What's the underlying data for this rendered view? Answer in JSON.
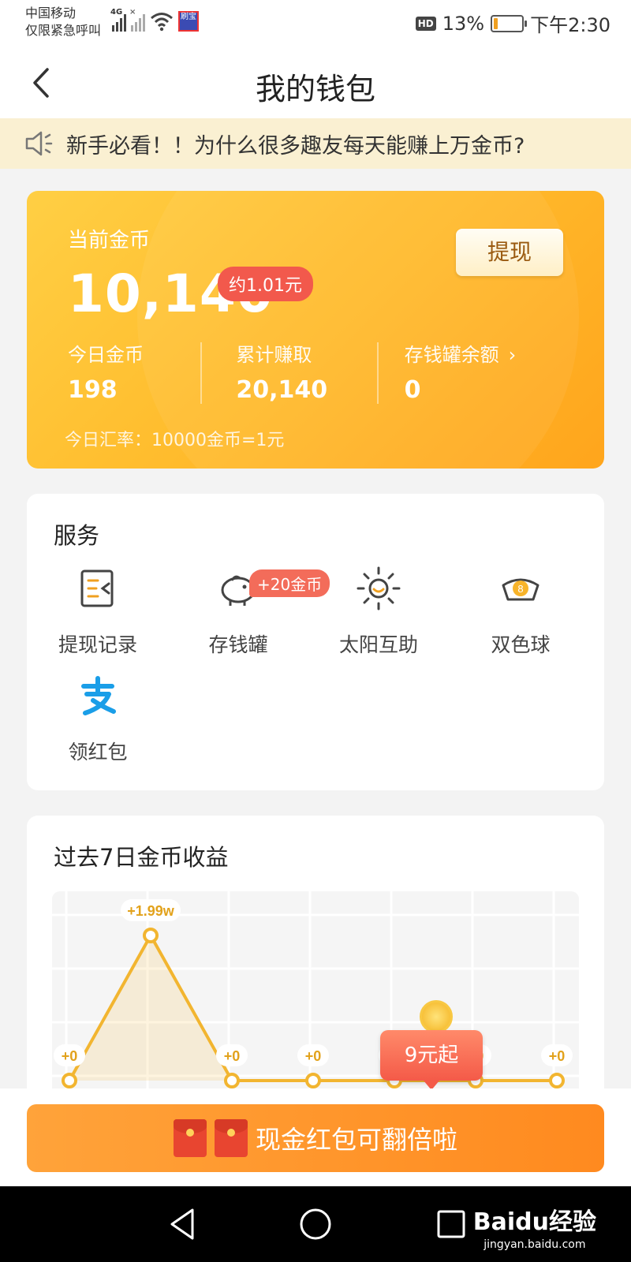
{
  "status_bar": {
    "carrier_line1": "中国移动",
    "carrier_line2": "仅限紧急呼叫",
    "network_tag": "4G",
    "app_badge": "刷宝",
    "hd": "HD",
    "battery_percent": "13%",
    "battery_level": 0.13,
    "time": "下午2:30"
  },
  "header": {
    "title": "我的钱包"
  },
  "notice": {
    "text": "新手必看！！为什么很多趣友每天能赚上万金币?"
  },
  "wallet": {
    "label": "当前金币",
    "amount": "10,140",
    "approx": "约1.01元",
    "withdraw_label": "提现",
    "stats": [
      {
        "label": "今日金币",
        "value": "198"
      },
      {
        "label": "累计赚取",
        "value": "20,140"
      },
      {
        "label": "存钱罐余额",
        "value": "0"
      }
    ],
    "rate": "今日汇率：10000金币=1元"
  },
  "services": {
    "title": "服务",
    "items": [
      {
        "label": "提现记录",
        "icon": "withdraw-record-icon"
      },
      {
        "label": "存钱罐",
        "icon": "piggy-bank-icon",
        "badge": "+20金币"
      },
      {
        "label": "太阳互助",
        "icon": "sun-icon"
      },
      {
        "label": "双色球",
        "icon": "lottery-ball-icon"
      },
      {
        "label": "领红包",
        "icon": "alipay-icon"
      }
    ]
  },
  "chart_card": {
    "title": "过去7日金币收益",
    "promo": "9元起"
  },
  "chart_data": {
    "type": "line",
    "point_labels": [
      "+0",
      "+1.99w",
      "+0",
      "+0",
      "+0",
      "+0",
      "+0"
    ],
    "values": [
      0,
      19900,
      0,
      0,
      0,
      0,
      0
    ],
    "grid": true
  },
  "cta": {
    "label": "现金红包可翻倍啦"
  },
  "watermark": {
    "brand": "Baidu经验",
    "url": "jingyan.baidu.com"
  }
}
